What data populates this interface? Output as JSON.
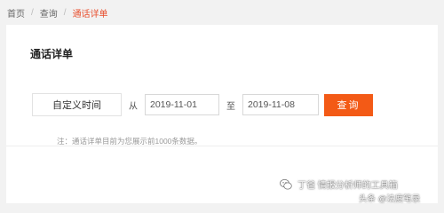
{
  "breadcrumb": {
    "items": [
      "首页",
      "查询",
      "通话详单"
    ],
    "separator": "/"
  },
  "panel": {
    "title": "通话详单"
  },
  "filter": {
    "custom_time_label": "自定义时间",
    "from_label": "从",
    "start_date": "2019-11-01",
    "to_label": "至",
    "end_date": "2019-11-08",
    "query_label": "查询"
  },
  "note": "注：通话详单目前为您展示前1000条数据。",
  "watermark": {
    "icon": "wechat-icon",
    "text": "丁爸 情报分析师的工具箱",
    "text2": "头条 @法度笔录"
  },
  "colors": {
    "accent": "#f35a16",
    "breadcrumb_active": "#e8502f",
    "background": "#f2f2f2"
  }
}
